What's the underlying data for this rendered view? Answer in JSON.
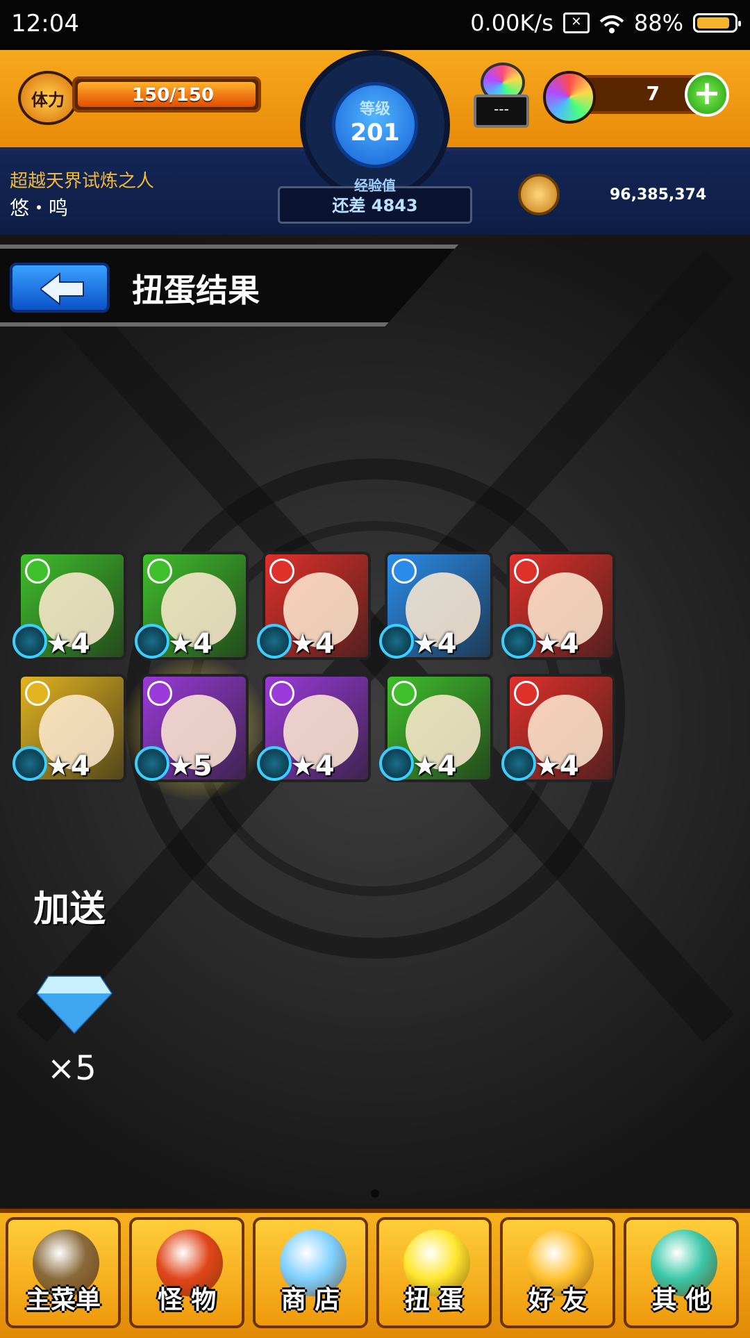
{
  "status_bar": {
    "time": "12:04",
    "net_speed": "0.00K/s",
    "battery": "88%",
    "battery_level": 0.88
  },
  "hud": {
    "stamina_label": "体力",
    "stamina": "150/150",
    "stamina_level": 1.0,
    "level_label": "等级",
    "level": "201",
    "exp_label": "经验值",
    "exp_remaining": "还差 4843",
    "egg_box": "---",
    "orbs": "7",
    "player_title": "超越天界试炼之人",
    "player_name": "悠・鸣",
    "coins": "96,385,374"
  },
  "header": {
    "title": "扭蛋结果",
    "back_icon": "back-arrow-icon"
  },
  "results": [
    {
      "stars": "★4",
      "element": "wood",
      "color": "#3fbf2a"
    },
    {
      "stars": "★4",
      "element": "wood",
      "color": "#3fbf2a"
    },
    {
      "stars": "★4",
      "element": "fire",
      "color": "#e0302a"
    },
    {
      "stars": "★4",
      "element": "water",
      "color": "#2a8bea"
    },
    {
      "stars": "★4",
      "element": "fire",
      "color": "#e0302a"
    },
    {
      "stars": "★4",
      "element": "light",
      "color": "#e2b420"
    },
    {
      "stars": "★5",
      "element": "dark",
      "color": "#9a3ad8"
    },
    {
      "stars": "★4",
      "element": "dark",
      "color": "#9a3ad8"
    },
    {
      "stars": "★4",
      "element": "wood",
      "color": "#3fbf2a"
    },
    {
      "stars": "★4",
      "element": "fire",
      "color": "#e0302a"
    }
  ],
  "bonus": {
    "label": "加送",
    "gem_count": "×5",
    "icon": "diamond-gem-icon"
  },
  "nav": [
    {
      "label": "主菜单",
      "icon": "gate-icon",
      "color": "#8a6a3a"
    },
    {
      "label": "怪 物",
      "icon": "monster-icon",
      "color": "#e0461a"
    },
    {
      "label": "商 店",
      "icon": "rainbow-orb-icon",
      "color": "#7fd0ff"
    },
    {
      "label": "扭 蛋",
      "icon": "egg-icon",
      "color": "#ffe72e"
    },
    {
      "label": "好 友",
      "icon": "friends-icon",
      "color": "#ffc22e"
    },
    {
      "label": "其 他",
      "icon": "question-icon",
      "color": "#3ac8a8"
    }
  ]
}
